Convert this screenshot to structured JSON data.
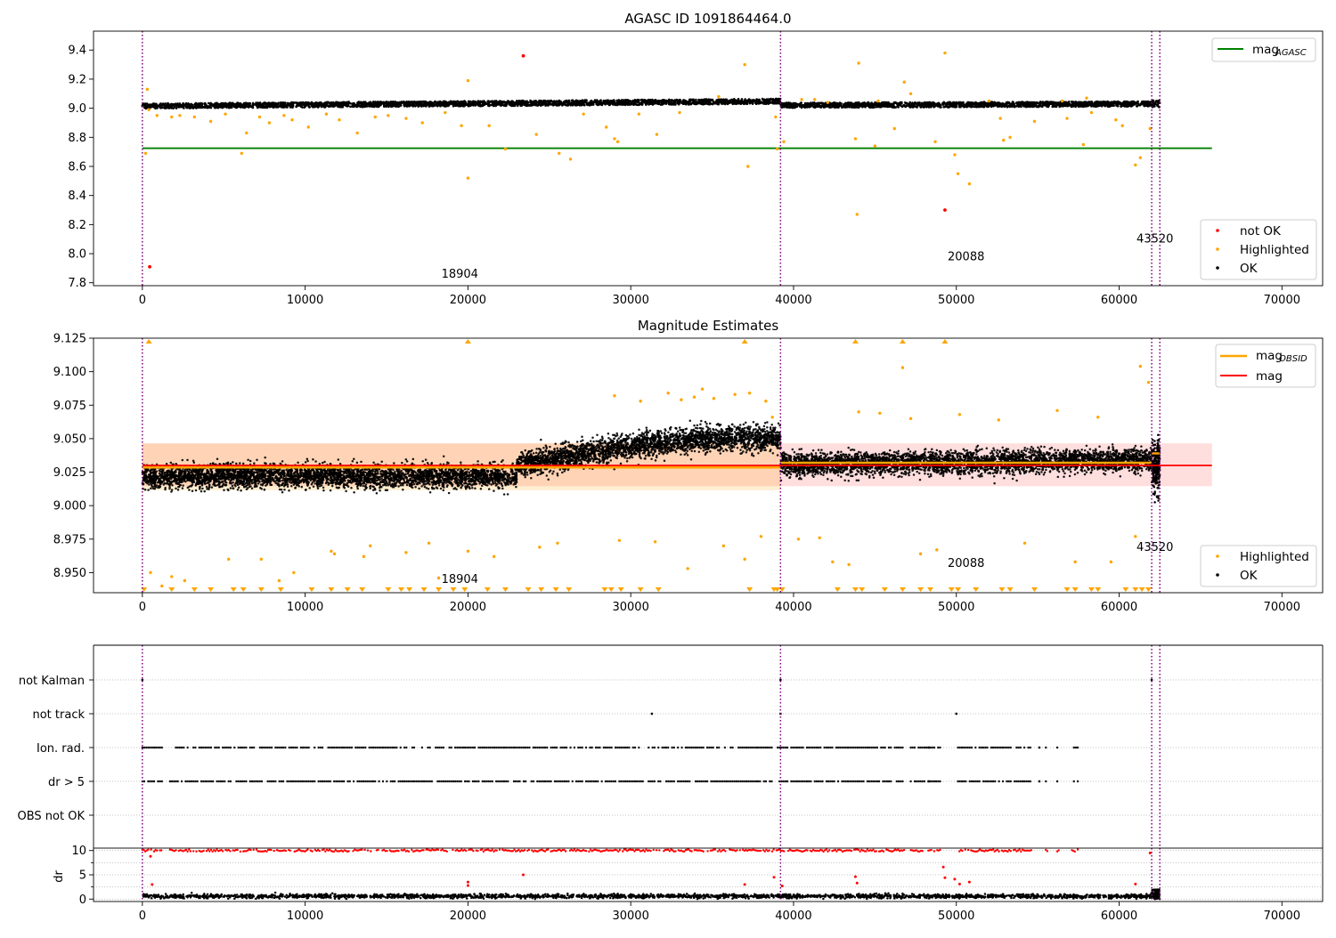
{
  "chart_data": [
    {
      "type": "scatter",
      "title": "AGASC ID 1091864464.0",
      "xlim": [
        -3000,
        72500
      ],
      "ylim": [
        7.78,
        9.53
      ],
      "x_ticks": [
        0,
        10000,
        20000,
        30000,
        40000,
        50000,
        60000,
        70000
      ],
      "x_tick_labels": [
        "0",
        "10000",
        "20000",
        "30000",
        "40000",
        "50000",
        "60000",
        "70000"
      ],
      "y_ticks": [
        7.8,
        8.0,
        8.2,
        8.4,
        8.6,
        8.8,
        9.0,
        9.2,
        9.4
      ],
      "y_tick_labels": [
        "7.8",
        "8.0",
        "8.2",
        "8.4",
        "8.6",
        "8.8",
        "9.0",
        "9.2",
        "9.4"
      ],
      "legend_top": {
        "placement": "upper right",
        "entries": [
          {
            "label_main": "mag",
            "label_sub": "AGASC",
            "color": "#008000",
            "marker": "line"
          }
        ]
      },
      "legend_bottom": {
        "placement": "lower right",
        "entries": [
          {
            "label": "not OK",
            "color": "#ff0000",
            "marker": "dot"
          },
          {
            "label": "Highlighted",
            "color": "#ffa500",
            "marker": "dot"
          },
          {
            "label": "OK",
            "color": "#000000",
            "marker": "dot"
          }
        ]
      },
      "agasc_mag": {
        "value": 8.725,
        "x_range": [
          0,
          65700
        ],
        "color": "#008000"
      },
      "obsid_boundaries": [
        0,
        39200,
        62000,
        62500
      ],
      "obsid_labels": [
        {
          "text": "18904",
          "x": 19500,
          "y": 7.86
        },
        {
          "text": "20088",
          "x": 50600,
          "y": 7.98
        },
        {
          "text": "43520",
          "x": 62200,
          "y": 8.1
        }
      ],
      "ok_band": [
        {
          "x": [
            0,
            39200
          ],
          "center": [
            9.015,
            9.048
          ],
          "width": 0.035
        },
        {
          "x": [
            39200,
            62000
          ],
          "center": [
            9.02,
            9.03
          ],
          "width": 0.035
        },
        {
          "x": [
            62000,
            62500
          ],
          "center": [
            9.032,
            9.032
          ],
          "width": 0.05
        }
      ],
      "highlighted_points": [
        [
          300,
          9.13
        ],
        [
          400,
          8.99
        ],
        [
          200,
          8.69
        ],
        [
          900,
          8.95
        ],
        [
          1800,
          8.94
        ],
        [
          2300,
          8.95
        ],
        [
          3200,
          8.94
        ],
        [
          4200,
          8.91
        ],
        [
          5100,
          8.96
        ],
        [
          6100,
          8.69
        ],
        [
          6400,
          8.83
        ],
        [
          7200,
          8.94
        ],
        [
          7800,
          8.9
        ],
        [
          8700,
          8.95
        ],
        [
          9200,
          8.92
        ],
        [
          10200,
          8.87
        ],
        [
          11300,
          8.96
        ],
        [
          12100,
          8.92
        ],
        [
          13200,
          8.83
        ],
        [
          14300,
          8.94
        ],
        [
          15100,
          8.95
        ],
        [
          16200,
          8.93
        ],
        [
          17200,
          8.9
        ],
        [
          18600,
          8.97
        ],
        [
          19600,
          8.88
        ],
        [
          20000,
          9.19
        ],
        [
          20000,
          8.52
        ],
        [
          21300,
          8.88
        ],
        [
          22300,
          8.72
        ],
        [
          24200,
          8.82
        ],
        [
          25600,
          8.69
        ],
        [
          26300,
          8.65
        ],
        [
          27100,
          8.96
        ],
        [
          28500,
          8.87
        ],
        [
          29000,
          8.79
        ],
        [
          29200,
          8.77
        ],
        [
          30500,
          8.96
        ],
        [
          31600,
          8.82
        ],
        [
          33000,
          8.97
        ],
        [
          35400,
          9.08
        ],
        [
          37000,
          9.3
        ],
        [
          37200,
          8.6
        ],
        [
          38900,
          8.94
        ],
        [
          39000,
          8.72
        ],
        [
          39400,
          8.77
        ],
        [
          40500,
          9.06
        ],
        [
          42100,
          9.04
        ],
        [
          43800,
          8.79
        ],
        [
          43900,
          8.27
        ],
        [
          44000,
          9.31
        ],
        [
          45000,
          8.74
        ],
        [
          46200,
          8.86
        ],
        [
          46800,
          9.18
        ],
        [
          47200,
          9.1
        ],
        [
          48700,
          8.77
        ],
        [
          49300,
          9.38
        ],
        [
          49900,
          8.68
        ],
        [
          50100,
          8.55
        ],
        [
          50800,
          8.48
        ],
        [
          52700,
          8.93
        ],
        [
          52900,
          8.78
        ],
        [
          53300,
          8.8
        ],
        [
          54800,
          8.91
        ],
        [
          56800,
          8.93
        ],
        [
          57800,
          8.75
        ],
        [
          58300,
          8.97
        ],
        [
          59800,
          8.92
        ],
        [
          60200,
          8.88
        ],
        [
          61000,
          8.61
        ],
        [
          61300,
          8.66
        ],
        [
          61900,
          8.86
        ],
        [
          58000,
          9.07
        ],
        [
          56500,
          9.05
        ],
        [
          52000,
          9.05
        ],
        [
          45200,
          9.05
        ],
        [
          41300,
          9.06
        ]
      ],
      "not_ok_points": [
        [
          23400,
          9.36
        ],
        [
          450,
          7.91
        ],
        [
          49300,
          8.3
        ]
      ]
    },
    {
      "type": "scatter",
      "title": "Magnitude Estimates",
      "xlim": [
        -3000,
        72500
      ],
      "ylim": [
        8.935,
        9.125
      ],
      "x_ticks": [
        0,
        10000,
        20000,
        30000,
        40000,
        50000,
        60000,
        70000
      ],
      "x_tick_labels": [
        "0",
        "10000",
        "20000",
        "30000",
        "40000",
        "50000",
        "60000",
        "70000"
      ],
      "y_ticks": [
        8.95,
        8.975,
        9.0,
        9.025,
        9.05,
        9.075,
        9.1,
        9.125
      ],
      "y_tick_labels": [
        "8.950",
        "8.975",
        "9.000",
        "9.025",
        "9.050",
        "9.075",
        "9.100",
        "9.125"
      ],
      "legend_top": {
        "placement": "upper right",
        "entries": [
          {
            "label_main": "mag",
            "label_sub": "OBSID",
            "color": "#ffa500",
            "marker": "line"
          },
          {
            "label": "mag",
            "color": "#ff0000",
            "marker": "line"
          }
        ]
      },
      "legend_bottom": {
        "placement": "lower right",
        "entries": [
          {
            "label": "Highlighted",
            "color": "#ffa500",
            "marker": "dot"
          },
          {
            "label": "OK",
            "color": "#000000",
            "marker": "dot"
          }
        ]
      },
      "mag": {
        "value": 9.03,
        "x_range": [
          0,
          65700
        ],
        "band": [
          9.0145,
          9.0465
        ],
        "color": "#ff0000"
      },
      "mag_obsid": [
        {
          "x": [
            0,
            39200
          ],
          "value": 9.0285
        },
        {
          "x": [
            39200,
            62000
          ],
          "value": 9.032
        },
        {
          "x": [
            62000,
            62500
          ],
          "value": 9.039
        }
      ],
      "obsid_bands": [
        {
          "x": [
            0,
            23500
          ],
          "range": [
            9.0115,
            9.0465
          ]
        },
        {
          "x": [
            23500,
            39200
          ],
          "range": [
            9.0115,
            9.0465
          ]
        }
      ],
      "obsid_boundaries": [
        0,
        39200,
        62000,
        62500
      ],
      "obsid_labels": [
        {
          "text": "18904",
          "x": 19500,
          "y": 8.945
        },
        {
          "text": "20088",
          "x": 50600,
          "y": 8.957
        },
        {
          "text": "43520",
          "x": 62200,
          "y": 8.969
        }
      ],
      "data_trend": [
        {
          "x": [
            0,
            23000
          ],
          "center": [
            9.022,
            9.022
          ],
          "spread": 0.025
        },
        {
          "x": [
            23000,
            39200
          ],
          "center": [
            9.03,
            9.05
          ],
          "spread": 0.026
        },
        {
          "x": [
            39200,
            62000
          ],
          "center": [
            9.031,
            9.034
          ],
          "spread": 0.024
        }
      ],
      "highlighted_points": [
        [
          500,
          8.95
        ],
        [
          1200,
          8.94
        ],
        [
          1800,
          8.947
        ],
        [
          2600,
          8.944
        ],
        [
          5300,
          8.96
        ],
        [
          7300,
          8.96
        ],
        [
          8400,
          8.944
        ],
        [
          9300,
          8.95
        ],
        [
          11600,
          8.966
        ],
        [
          11800,
          8.964
        ],
        [
          13600,
          8.962
        ],
        [
          14000,
          8.97
        ],
        [
          16200,
          8.965
        ],
        [
          17600,
          8.972
        ],
        [
          18200,
          8.946
        ],
        [
          20000,
          8.966
        ],
        [
          21600,
          8.962
        ],
        [
          24400,
          8.969
        ],
        [
          25500,
          8.972
        ],
        [
          29300,
          8.974
        ],
        [
          31500,
          8.973
        ],
        [
          33500,
          8.953
        ],
        [
          35700,
          8.97
        ],
        [
          37000,
          8.96
        ],
        [
          38000,
          8.977
        ],
        [
          38700,
          9.066
        ],
        [
          40300,
          8.975
        ],
        [
          41600,
          8.976
        ],
        [
          42400,
          8.958
        ],
        [
          43400,
          8.956
        ],
        [
          44000,
          9.07
        ],
        [
          45300,
          9.069
        ],
        [
          46700,
          9.103
        ],
        [
          47200,
          9.065
        ],
        [
          47800,
          8.964
        ],
        [
          48800,
          8.967
        ],
        [
          50200,
          9.068
        ],
        [
          52600,
          9.064
        ],
        [
          54200,
          8.972
        ],
        [
          56200,
          9.071
        ],
        [
          57300,
          8.958
        ],
        [
          58700,
          9.066
        ],
        [
          59500,
          8.958
        ],
        [
          61000,
          8.977
        ],
        [
          61300,
          9.104
        ],
        [
          61800,
          9.092
        ],
        [
          29000,
          9.082
        ],
        [
          30600,
          9.078
        ],
        [
          32300,
          9.084
        ],
        [
          33900,
          9.081
        ],
        [
          35100,
          9.08
        ],
        [
          36400,
          9.083
        ],
        [
          37300,
          9.084
        ],
        [
          38300,
          9.078
        ],
        [
          34400,
          9.087
        ],
        [
          33100,
          9.079
        ]
      ],
      "highlighted_clipped_top": [
        400,
        20000,
        37000,
        43800,
        46700,
        49300
      ],
      "highlighted_clipped_bottom": [
        100,
        1800,
        3200,
        4200,
        5600,
        6200,
        7300,
        8500,
        10400,
        11600,
        12600,
        13500,
        15100,
        15900,
        16400,
        17300,
        18200,
        19100,
        19800,
        21200,
        22300,
        23700,
        24500,
        25400,
        26200,
        28400,
        28800,
        29400,
        30600,
        31700,
        37300,
        38800,
        39000,
        39300,
        42700,
        43800,
        44200,
        45600,
        46700,
        47800,
        48400,
        49700,
        50100,
        51200,
        52800,
        53300,
        54800,
        56800,
        57300,
        58300,
        58700,
        60400,
        61000,
        61400,
        61800
      ]
    },
    {
      "type": "scatter",
      "title": "",
      "xlim": [
        -3000,
        72500
      ],
      "categories": [
        "not Kalman",
        "not track",
        "Ion. rad.",
        "dr > 5",
        "OBS not OK"
      ],
      "flags": {
        "not Kalman": [
          0,
          39200,
          62000
        ],
        "not track": [
          31300,
          39200,
          50000
        ],
        "Ion. rad.": {
          "segments": [
            [
              0,
              1200
            ],
            [
              1700,
              46800
            ],
            [
              47200,
              49000
            ],
            [
              50100,
              54600
            ],
            [
              55500,
              55600
            ],
            [
              56200,
              56300
            ],
            [
              57100,
              57500
            ]
          ],
          "isolated": [
            48300,
            55100
          ]
        },
        "dr > 5": {
          "segments": [
            [
              0,
              1200
            ],
            [
              1700,
              46800
            ],
            [
              47200,
              49000
            ],
            [
              50100,
              54600
            ],
            [
              55500,
              55600
            ],
            [
              56200,
              56300
            ],
            [
              57100,
              57500
            ]
          ],
          "isolated": [
            48300,
            55100
          ]
        },
        "OBS not OK": []
      }
    },
    {
      "type": "scatter",
      "title": "",
      "ylabel": "dr",
      "xlim": [
        -3000,
        72500
      ],
      "ylim": [
        -0.5,
        10.5
      ],
      "x_ticks": [
        0,
        10000,
        20000,
        30000,
        40000,
        50000,
        60000,
        70000
      ],
      "x_tick_labels": [
        "0",
        "10000",
        "20000",
        "30000",
        "40000",
        "50000",
        "60000",
        "70000"
      ],
      "y_ticks": [
        0,
        5,
        10
      ],
      "y_tick_labels": [
        "0",
        "5",
        "10"
      ],
      "y_minor_ticks": [
        2.5,
        7.5
      ],
      "clipped_value": 10,
      "clipped_segments": [
        [
          0,
          1200
        ],
        [
          1700,
          46800
        ],
        [
          47200,
          49000
        ],
        [
          50100,
          54600
        ],
        [
          55500,
          55600
        ],
        [
          56200,
          56300
        ],
        [
          57100,
          57500
        ]
      ],
      "red_outliers": [
        [
          500,
          8.8
        ],
        [
          600,
          3.0
        ],
        [
          20000,
          3.5
        ],
        [
          20000,
          2.8
        ],
        [
          23400,
          5.0
        ],
        [
          37000,
          3.0
        ],
        [
          38800,
          4.5
        ],
        [
          39300,
          2.7
        ],
        [
          43800,
          4.6
        ],
        [
          43900,
          3.3
        ],
        [
          49200,
          6.6
        ],
        [
          49300,
          4.4
        ],
        [
          49900,
          4.1
        ],
        [
          50200,
          3.1
        ],
        [
          50800,
          3.5
        ],
        [
          61000,
          3.1
        ],
        [
          61900,
          9.5
        ]
      ],
      "ok_band": {
        "center": 0.6,
        "spread": 0.7
      }
    }
  ]
}
